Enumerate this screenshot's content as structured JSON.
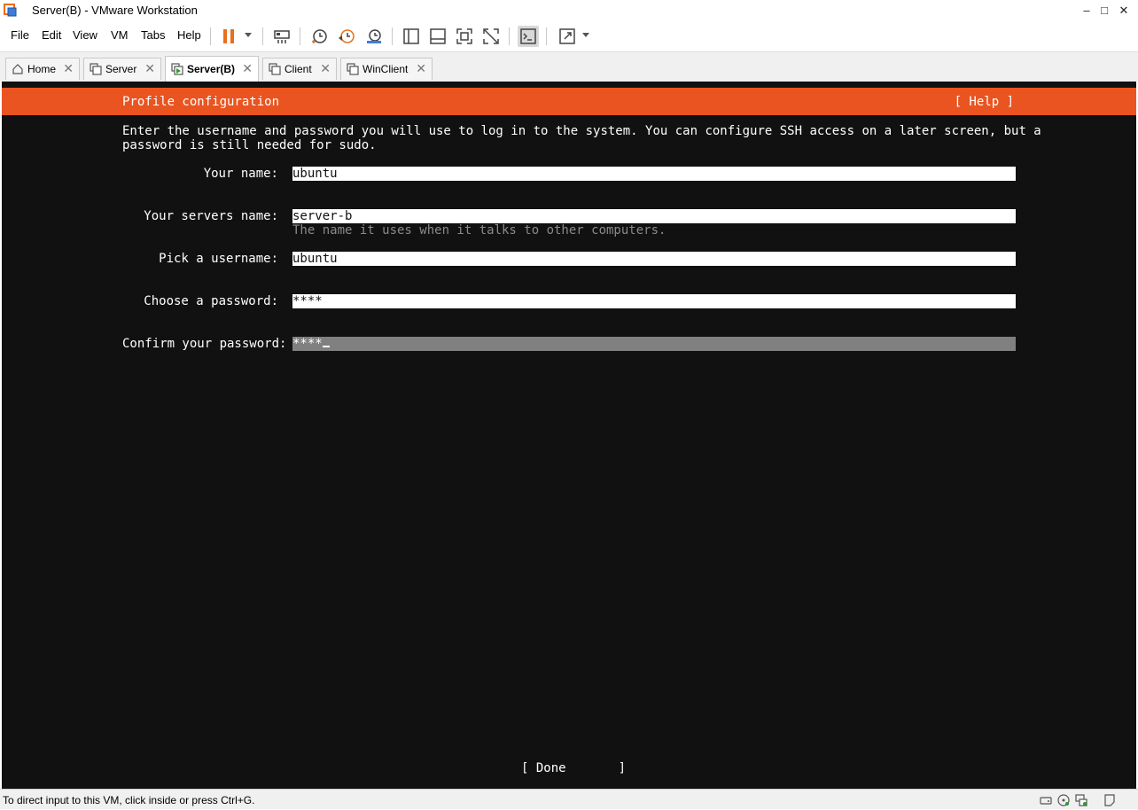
{
  "window": {
    "title": "Server(B) - VMware Workstation",
    "minimize_glyph": "–",
    "maximize_glyph": "□",
    "close_glyph": "✕"
  },
  "menu": {
    "items": [
      "File",
      "Edit",
      "View",
      "VM",
      "Tabs",
      "Help"
    ]
  },
  "toolbar": {
    "icons": [
      "pause-icon",
      "send-ctrl-alt-del-icon",
      "snapshot-icon",
      "revert-snapshot-icon",
      "snapshot-manager-icon",
      "library-icon",
      "thumbnail-bar-icon",
      "full-screen-icon",
      "unity-icon",
      "console-view-icon",
      "stretch-icon"
    ],
    "accent_color": "#e86f1c"
  },
  "tabs": [
    {
      "label": "Home",
      "active": false
    },
    {
      "label": "Server",
      "active": false
    },
    {
      "label": "Server(B)",
      "active": true
    },
    {
      "label": "Client",
      "active": false
    },
    {
      "label": "WinClient",
      "active": false
    }
  ],
  "tab_close_glyph": "✕",
  "installer": {
    "header_title": "Profile configuration",
    "help_label": "[ Help ]",
    "header_color": "#e95420",
    "description_line1": "Enter the username and password you will use to log in to the system. You can configure SSH access on a later screen, but a",
    "description_line2": "password is still needed for sudo.",
    "fields": {
      "your_name": {
        "label": "Your name:",
        "value": "ubuntu"
      },
      "server_name": {
        "label": "Your servers name:",
        "value": "server-b",
        "hint": "The name it uses when it talks to other computers."
      },
      "username": {
        "label": "Pick a username:",
        "value": "ubuntu"
      },
      "password": {
        "label": "Choose a password:",
        "value": "****"
      },
      "confirm_password": {
        "label": "Confirm your password:",
        "value": "****"
      }
    },
    "done_label": "[ Done       ]"
  },
  "statusbar": {
    "message": "To direct input to this VM, click inside or press Ctrl+G."
  }
}
